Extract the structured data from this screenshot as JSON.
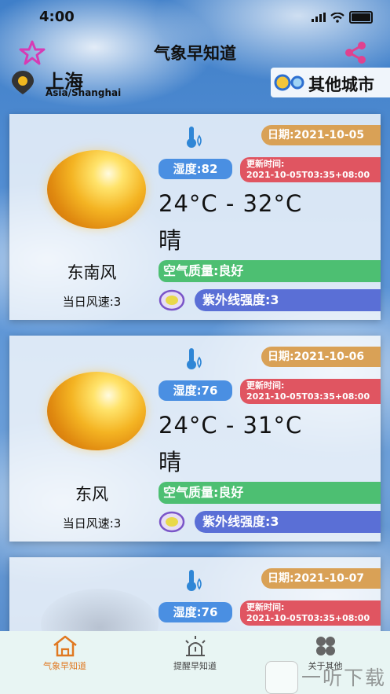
{
  "status_bar": {
    "time": "4:00"
  },
  "header": {
    "title": "气象早知道"
  },
  "location": {
    "city": "上海",
    "timezone": "Asia/Shanghai",
    "other_city_label": "其他城市"
  },
  "cards": [
    {
      "date": "日期:2021-10-05",
      "humidity": "湿度:82",
      "update_label": "更新时间:",
      "update_time": "2021-10-05T03:35+08:00",
      "temperature": "24°C - 32°C",
      "condition": "晴",
      "wind_direction": "东南风",
      "wind_speed": "当日风速:3",
      "air_quality": "空气质量:良好",
      "uv": "紫外线强度:3"
    },
    {
      "date": "日期:2021-10-06",
      "humidity": "湿度:76",
      "update_label": "更新时间:",
      "update_time": "2021-10-05T03:35+08:00",
      "temperature": "24°C - 31°C",
      "condition": "晴",
      "wind_direction": "东风",
      "wind_speed": "当日风速:3",
      "air_quality": "空气质量:良好",
      "uv": "紫外线强度:3"
    },
    {
      "date": "日期:2021-10-07",
      "humidity": "湿度:76",
      "update_label": "更新时间:",
      "update_time": "2021-10-05T03:35+08:00"
    }
  ],
  "tabbar": {
    "tab1": "气象早知道",
    "tab2": "提醒早知道",
    "tab3": "关于其他"
  },
  "watermark": {
    "text": "一听下载"
  },
  "colors": {
    "accent": "#e07820",
    "star": "#d63bb4",
    "share": "#e0428f"
  }
}
